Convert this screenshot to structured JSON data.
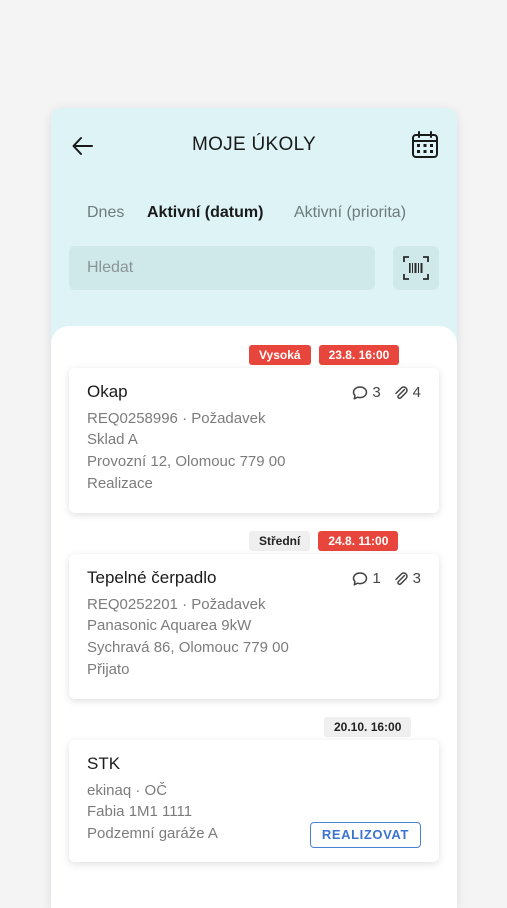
{
  "header": {
    "title": "MOJE ÚKOLY",
    "back_icon": "arrow-left-icon",
    "calendar_icon": "calendar-icon"
  },
  "tabs": [
    {
      "label": "Dnes",
      "active": false
    },
    {
      "label": "Aktivní (datum)",
      "active": true
    },
    {
      "label": "Aktivní (priorita)",
      "active": false
    }
  ],
  "search": {
    "placeholder": "Hledat",
    "value": ""
  },
  "scan_icon": "barcode-scan-icon",
  "colors": {
    "header_bg": "#ddf3f5",
    "priority_red": "#e8463c",
    "accent_blue": "#3c74d2"
  },
  "tasks": [
    {
      "priority": "Vysoká",
      "due": "23.8. 16:00",
      "title": "Okap",
      "line1": "REQ0258996 · Požadavek",
      "line2": "Sklad A",
      "line3": "Provozní 12, Olomouc 779 00",
      "line4": "Realizace",
      "comments": "3",
      "attachments": "4"
    },
    {
      "priority": "Střední",
      "due": "24.8. 11:00",
      "title": "Tepelné čerpadlo",
      "line1": "REQ0252201 · Požadavek",
      "line2": "Panasonic Aquarea 9kW",
      "line3": "Sychravá 86, Olomouc 779 00",
      "line4": "Přijato",
      "comments": "1",
      "attachments": "3"
    },
    {
      "due": "20.10. 16:00",
      "title": "STK",
      "line1": "ekinaq · OČ",
      "line2": "Fabia 1M1 1111",
      "line3": "Podzemní garáže A",
      "action": "REALIZOVAT"
    }
  ]
}
